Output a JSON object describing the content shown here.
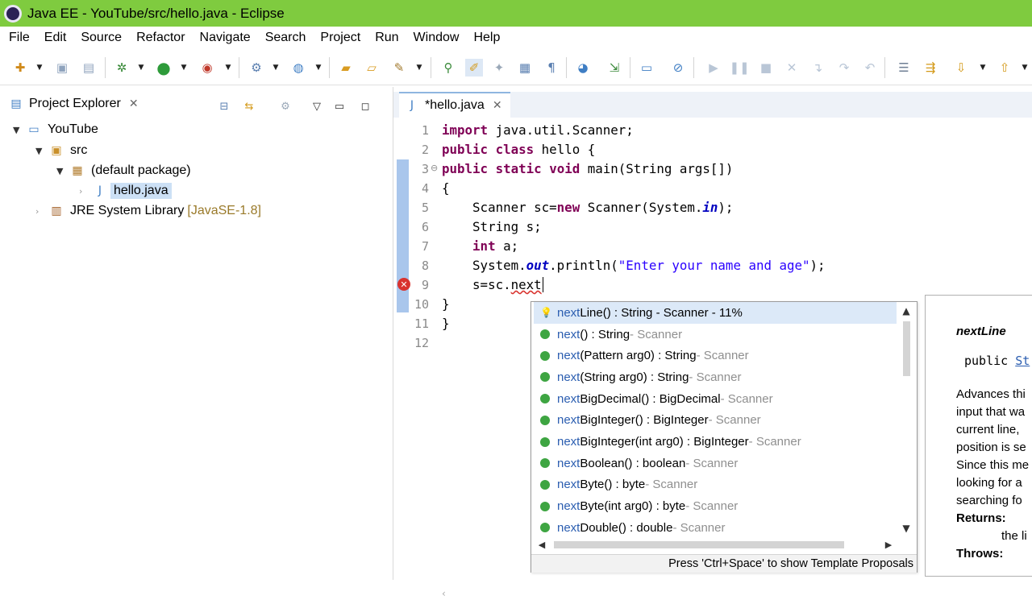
{
  "window": {
    "title": "Java EE - YouTube/src/hello.java - Eclipse"
  },
  "menu": [
    "File",
    "Edit",
    "Source",
    "Refactor",
    "Navigate",
    "Search",
    "Project",
    "Run",
    "Window",
    "Help"
  ],
  "explorer": {
    "title": "Project Explorer",
    "tree": {
      "project": "YouTube",
      "src": "src",
      "package": "(default package)",
      "file": "hello.java",
      "jre": "JRE System Library",
      "jre_decor": "[JavaSE-1.8]"
    }
  },
  "editor": {
    "tab_title": "*hello.java",
    "lines": [
      {
        "n": "1",
        "code": "import java.util.Scanner;"
      },
      {
        "n": "2",
        "code": "public class hello {"
      },
      {
        "n": "3",
        "code": "public static void main(String args[])"
      },
      {
        "n": "4",
        "code": "{"
      },
      {
        "n": "5",
        "code": "    Scanner sc=new Scanner(System.in);"
      },
      {
        "n": "6",
        "code": "    String s;"
      },
      {
        "n": "7",
        "code": "    int a;"
      },
      {
        "n": "8",
        "code": "    System.out.println(\"Enter your name and age\");"
      },
      {
        "n": "9",
        "code": "    s=sc.next"
      },
      {
        "n": "10",
        "code": "}"
      },
      {
        "n": "11",
        "code": "}"
      },
      {
        "n": "12",
        "code": ""
      }
    ]
  },
  "content_assist": {
    "proposals": [
      {
        "match": "next",
        "rest": "Line() : String - Scanner - 11%",
        "qual": ""
      },
      {
        "match": "next",
        "rest": "() : String",
        "qual": " - Scanner"
      },
      {
        "match": "next",
        "rest": "(Pattern arg0) : String",
        "qual": " - Scanner"
      },
      {
        "match": "next",
        "rest": "(String arg0) : String",
        "qual": " - Scanner"
      },
      {
        "match": "next",
        "rest": "BigDecimal() : BigDecimal",
        "qual": " - Scanner"
      },
      {
        "match": "next",
        "rest": "BigInteger() : BigInteger",
        "qual": " - Scanner"
      },
      {
        "match": "next",
        "rest": "BigInteger(int arg0) : BigInteger",
        "qual": " - Scanner"
      },
      {
        "match": "next",
        "rest": "Boolean() : boolean",
        "qual": " - Scanner"
      },
      {
        "match": "next",
        "rest": "Byte() : byte",
        "qual": " - Scanner"
      },
      {
        "match": "next",
        "rest": "Byte(int arg0) : byte",
        "qual": " - Scanner"
      },
      {
        "match": "next",
        "rest": "Double() : double",
        "qual": " - Scanner"
      }
    ],
    "status": "Press 'Ctrl+Space' to show Template Proposals"
  },
  "javadoc": {
    "title": "nextLine",
    "sig_prefix": "public ",
    "sig_type": "St",
    "desc": [
      "Advances thi",
      "input that wa",
      "current line, ",
      "position is se",
      "Since this me",
      "looking for a",
      "searching fo"
    ],
    "returns_label": "Returns:",
    "returns_text": "the li",
    "throws_label": "Throws:"
  },
  "colors": {
    "titlebar": "#7fcb3f",
    "keyword": "#7f0055",
    "string": "#2a00ff",
    "field": "#0000c0",
    "selection": "#dce9f8",
    "accent": "#2a5db0"
  }
}
